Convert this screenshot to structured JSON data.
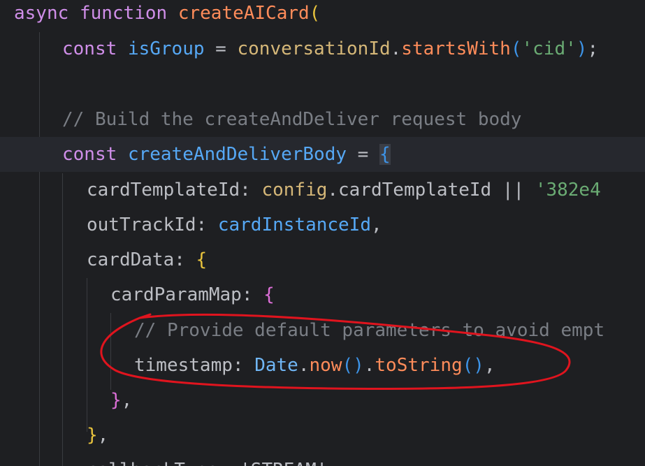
{
  "editor": {
    "lines": [
      {
        "tokens": [
          {
            "t": "async",
            "c": "kw"
          },
          {
            "t": " "
          },
          {
            "t": "function",
            "c": "kw"
          },
          {
            "t": " "
          },
          {
            "t": "createAICard",
            "c": "fndecl"
          },
          {
            "t": "(",
            "c": "paren-y"
          }
        ]
      },
      {
        "tokens": [
          {
            "t": "const",
            "c": "kw"
          },
          {
            "t": " "
          },
          {
            "t": "isGroup",
            "c": "fn"
          },
          {
            "t": " = "
          },
          {
            "t": "conversationId",
            "c": "obj"
          },
          {
            "t": "."
          },
          {
            "t": "startsWith",
            "c": "method"
          },
          {
            "t": "(",
            "c": "paren-b"
          },
          {
            "t": "'cid'",
            "c": "str"
          },
          {
            "t": ")",
            "c": "paren-b"
          },
          {
            "t": ";"
          }
        ]
      },
      {
        "tokens": []
      },
      {
        "tokens": [
          {
            "t": "// Build the createAndDeliver request body",
            "c": "comment"
          }
        ]
      },
      {
        "tokens": [
          {
            "t": "const",
            "c": "kw"
          },
          {
            "t": " "
          },
          {
            "t": "createAndDeliverBody",
            "c": "fn"
          },
          {
            "t": " = "
          },
          {
            "t": "{",
            "c": "brace-hl"
          }
        ]
      },
      {
        "tokens": [
          {
            "t": "cardTemplateId: "
          },
          {
            "t": "config",
            "c": "obj"
          },
          {
            "t": "."
          },
          {
            "t": "cardTemplateId"
          },
          {
            "t": " || "
          },
          {
            "t": "'382e4",
            "c": "str"
          }
        ]
      },
      {
        "tokens": [
          {
            "t": "outTrackId: "
          },
          {
            "t": "cardInstanceId",
            "c": "fn"
          },
          {
            "t": ","
          }
        ]
      },
      {
        "tokens": [
          {
            "t": "cardData: "
          },
          {
            "t": "{",
            "c": "paren-y"
          }
        ]
      },
      {
        "tokens": [
          {
            "t": "cardParamMap: "
          },
          {
            "t": "{",
            "c": "paren-p"
          }
        ]
      },
      {
        "tokens": [
          {
            "t": "// Provide default parameters to avoid empt",
            "c": "comment"
          }
        ]
      },
      {
        "tokens": [
          {
            "t": "timestamp: "
          },
          {
            "t": "Date",
            "c": "cls"
          },
          {
            "t": "."
          },
          {
            "t": "now",
            "c": "method"
          },
          {
            "t": "()",
            "c": "paren-b"
          },
          {
            "t": "."
          },
          {
            "t": "toString",
            "c": "method"
          },
          {
            "t": "()",
            "c": "paren-b"
          },
          {
            "t": ","
          }
        ]
      },
      {
        "tokens": [
          {
            "t": "}",
            "c": "paren-p"
          },
          {
            "t": ","
          }
        ]
      },
      {
        "tokens": [
          {
            "t": "}",
            "c": "paren-y"
          },
          {
            "t": ","
          }
        ]
      },
      {
        "tokens": [
          {
            "t": "callbackType: 'STREAM',",
            "c": "var"
          }
        ]
      }
    ]
  },
  "annotation": {
    "color": "#e0141e",
    "shape": "ellipse-freehand"
  }
}
